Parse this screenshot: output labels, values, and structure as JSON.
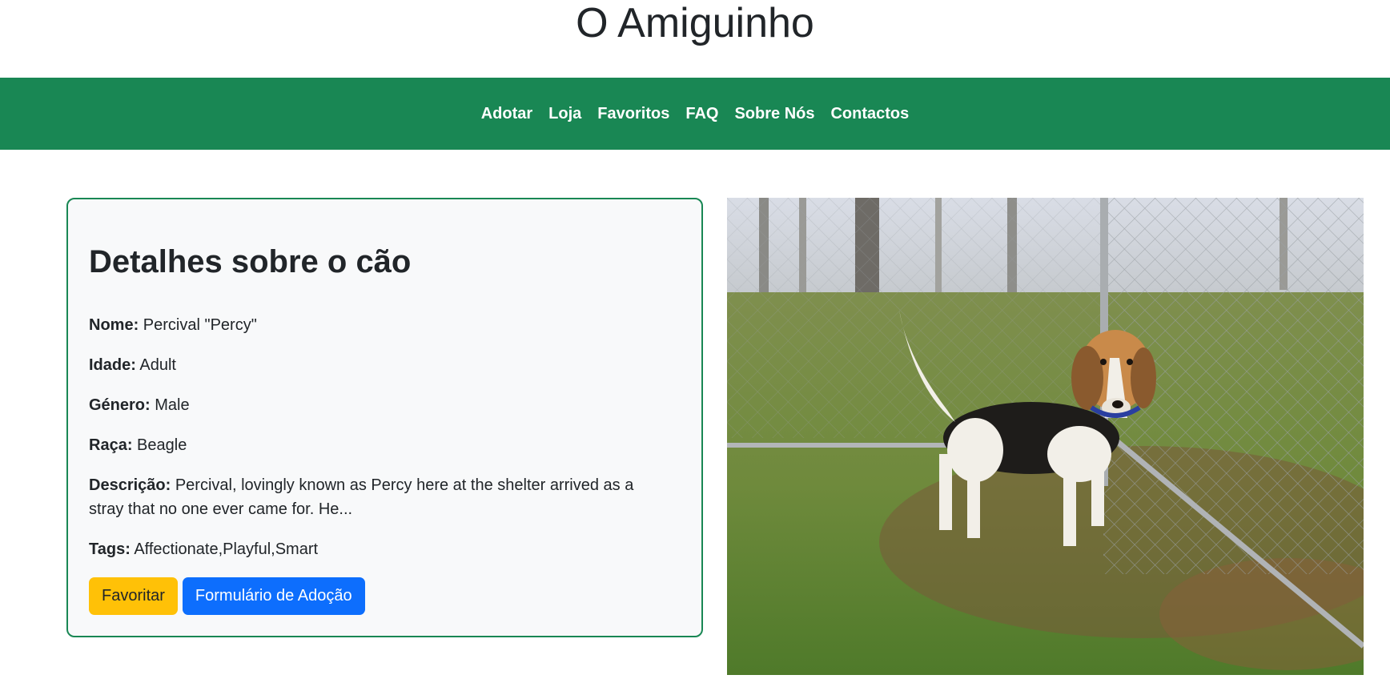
{
  "site": {
    "title": "O Amiguinho"
  },
  "nav": {
    "items": [
      "Adotar",
      "Loja",
      "Favoritos",
      "FAQ",
      "Sobre Nós",
      "Contactos"
    ]
  },
  "details": {
    "title": "Detalhes sobre o cão",
    "fields": [
      {
        "label": "Nome:",
        "value": "Percival \"Percy\""
      },
      {
        "label": "Idade:",
        "value": "Adult"
      },
      {
        "label": "Género:",
        "value": "Male"
      },
      {
        "label": "Raça:",
        "value": "Beagle"
      },
      {
        "label": "Descrição:",
        "value": "Percival, lovingly known as Percy here at the shelter arrived as a stray that no one ever came for. He..."
      },
      {
        "label": "Tags:",
        "value": "Affectionate,Playful,Smart"
      }
    ],
    "buttons": {
      "favorite": "Favoritar",
      "adoption_form": "Formulário de Adoção"
    }
  },
  "photo": {
    "subject": "beagle-dog-photo"
  },
  "colors": {
    "nav_bg": "#198754",
    "card_border": "#198754",
    "favorite_btn": "#ffc107",
    "adopt_btn": "#0d6efd"
  }
}
